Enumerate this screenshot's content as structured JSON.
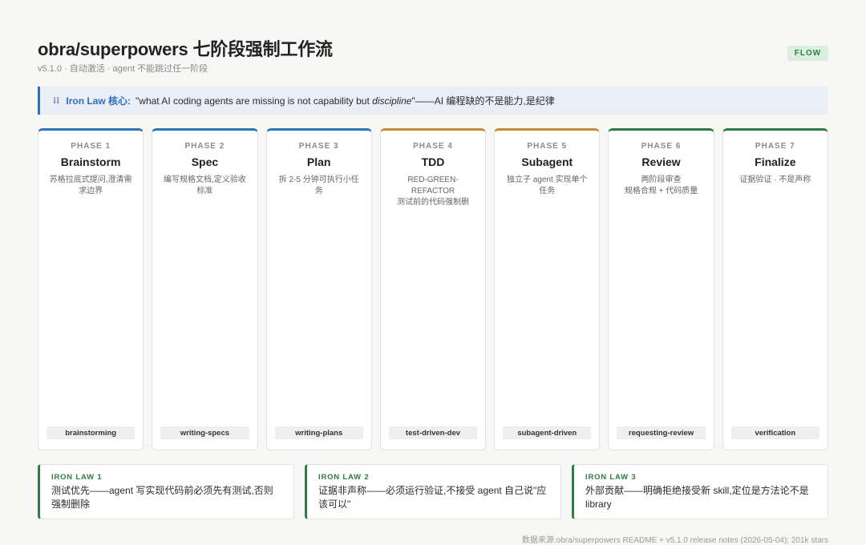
{
  "header": {
    "title": "obra/superpowers 七阶段强制工作流",
    "subtitle": "v5.1.0 · 自动激活 · agent 不能跳过任一阶段",
    "badge": "FLOW"
  },
  "banner": {
    "icon": "⁝⁝",
    "key": "Iron Law 核心:",
    "quote_before": "\"what AI coding agents are missing is not capability but ",
    "quote_em": "discipline",
    "quote_after": "\"——AI 编程缺的不是能力,是纪律"
  },
  "phases": [
    {
      "label": "PHASE 1",
      "name": "Brainstorm",
      "desc": "苏格拉底式提问,澄清需求边界",
      "skill": "brainstorming",
      "color": "#2f74b5"
    },
    {
      "label": "PHASE 2",
      "name": "Spec",
      "desc": "编写规格文档,定义验收标准",
      "skill": "writing-specs",
      "color": "#2f74b5"
    },
    {
      "label": "PHASE 3",
      "name": "Plan",
      "desc": "拆 2-5 分钟可执行小任务",
      "skill": "writing-plans",
      "color": "#2f74b5"
    },
    {
      "label": "PHASE 4",
      "name": "TDD",
      "desc": "RED-GREEN-REFACTOR\n测试前的代码强制删",
      "skill": "test-driven-dev",
      "color": "#c98a3a"
    },
    {
      "label": "PHASE 5",
      "name": "Subagent",
      "desc": "独立子 agent 实现单个任务",
      "skill": "subagent-driven",
      "color": "#c98a3a"
    },
    {
      "label": "PHASE 6",
      "name": "Review",
      "desc": "两阶段审查\n规格合规 + 代码质量",
      "skill": "requesting-review",
      "color": "#2f7d45"
    },
    {
      "label": "PHASE 7",
      "name": "Finalize",
      "desc": "证据验证 · 不是声称",
      "skill": "verification",
      "color": "#2f7d45"
    }
  ],
  "laws": [
    {
      "label": "IRON LAW 1",
      "text": "测试优先——agent 写实现代码前必须先有测试,否则强制删除"
    },
    {
      "label": "IRON LAW 2",
      "text": "证据非声称——必须运行验证,不接受 agent 自己说\"应该可以\""
    },
    {
      "label": "IRON LAW 3",
      "text": "外部贡献——明确拒绝接受新 skill,定位是方法论不是 library"
    }
  ],
  "footer": {
    "source": "数据来源:obra/superpowers README + v5.1.0 release notes (2026-05-04); 201k stars"
  }
}
